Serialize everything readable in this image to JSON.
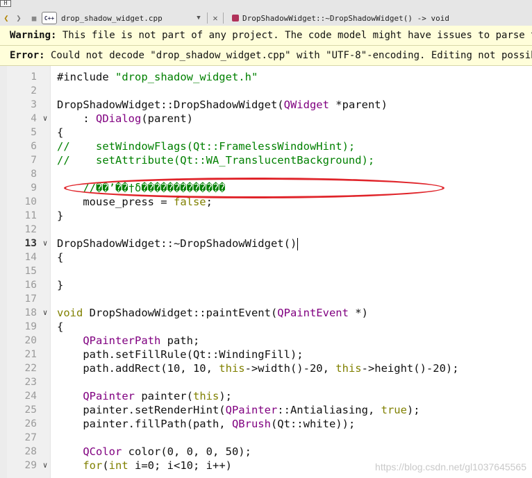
{
  "toolbar": {
    "window_stub": "H",
    "filename": "drop_shadow_widget.cpp",
    "file_icon_text": "C++",
    "symbol": "DropShadowWidget::~DropShadowWidget() -> void"
  },
  "infobars": {
    "warning_label": "Warning:",
    "warning_text": " This file is not part of any project. The code model might have issues to parse this",
    "error_label": "Error:",
    "error_text": " Could not decode \"drop_shadow_widget.cpp\" with \"UTF-8\"-encoding. Editing not possible."
  },
  "editor": {
    "current_line": "13",
    "lines": [
      {
        "n": "1",
        "t": "#include \"drop_shadow_widget.h\""
      },
      {
        "n": "2",
        "t": ""
      },
      {
        "n": "3",
        "t": "DropShadowWidget::DropShadowWidget(QWidget *parent)"
      },
      {
        "n": "4",
        "t": "    : QDialog(parent)"
      },
      {
        "n": "5",
        "t": "{"
      },
      {
        "n": "6",
        "t": "//    setWindowFlags(Qt::FramelessWindowHint);"
      },
      {
        "n": "7",
        "t": "//    setAttribute(Qt::WA_TranslucentBackground);"
      },
      {
        "n": "8",
        "t": ""
      },
      {
        "n": "9",
        "t": "    //��’��†δ�������������"
      },
      {
        "n": "10",
        "t": "    mouse_press = false;"
      },
      {
        "n": "11",
        "t": "}"
      },
      {
        "n": "12",
        "t": ""
      },
      {
        "n": "13",
        "t": "DropShadowWidget::~DropShadowWidget()"
      },
      {
        "n": "14",
        "t": "{"
      },
      {
        "n": "15",
        "t": ""
      },
      {
        "n": "16",
        "t": "}"
      },
      {
        "n": "17",
        "t": ""
      },
      {
        "n": "18",
        "t": "void DropShadowWidget::paintEvent(QPaintEvent *)"
      },
      {
        "n": "19",
        "t": "{"
      },
      {
        "n": "20",
        "t": "    QPainterPath path;"
      },
      {
        "n": "21",
        "t": "    path.setFillRule(Qt::WindingFill);"
      },
      {
        "n": "22",
        "t": "    path.addRect(10, 10, this->width()-20, this->height()-20);"
      },
      {
        "n": "23",
        "t": ""
      },
      {
        "n": "24",
        "t": "    QPainter painter(this);"
      },
      {
        "n": "25",
        "t": "    painter.setRenderHint(QPainter::Antialiasing, true);"
      },
      {
        "n": "26",
        "t": "    painter.fillPath(path, QBrush(Qt::white));"
      },
      {
        "n": "27",
        "t": ""
      },
      {
        "n": "28",
        "t": "    QColor color(0, 0, 0, 50);"
      },
      {
        "n": "29",
        "t": "    for(int i=0; i<10; i++)"
      }
    ]
  },
  "watermark": "https://blog.csdn.net/gl1037645565",
  "colors": {
    "keyword": "#808000",
    "string": "#008000",
    "type": "#800080",
    "function": "#00677c",
    "annotation": "#e0242a"
  }
}
